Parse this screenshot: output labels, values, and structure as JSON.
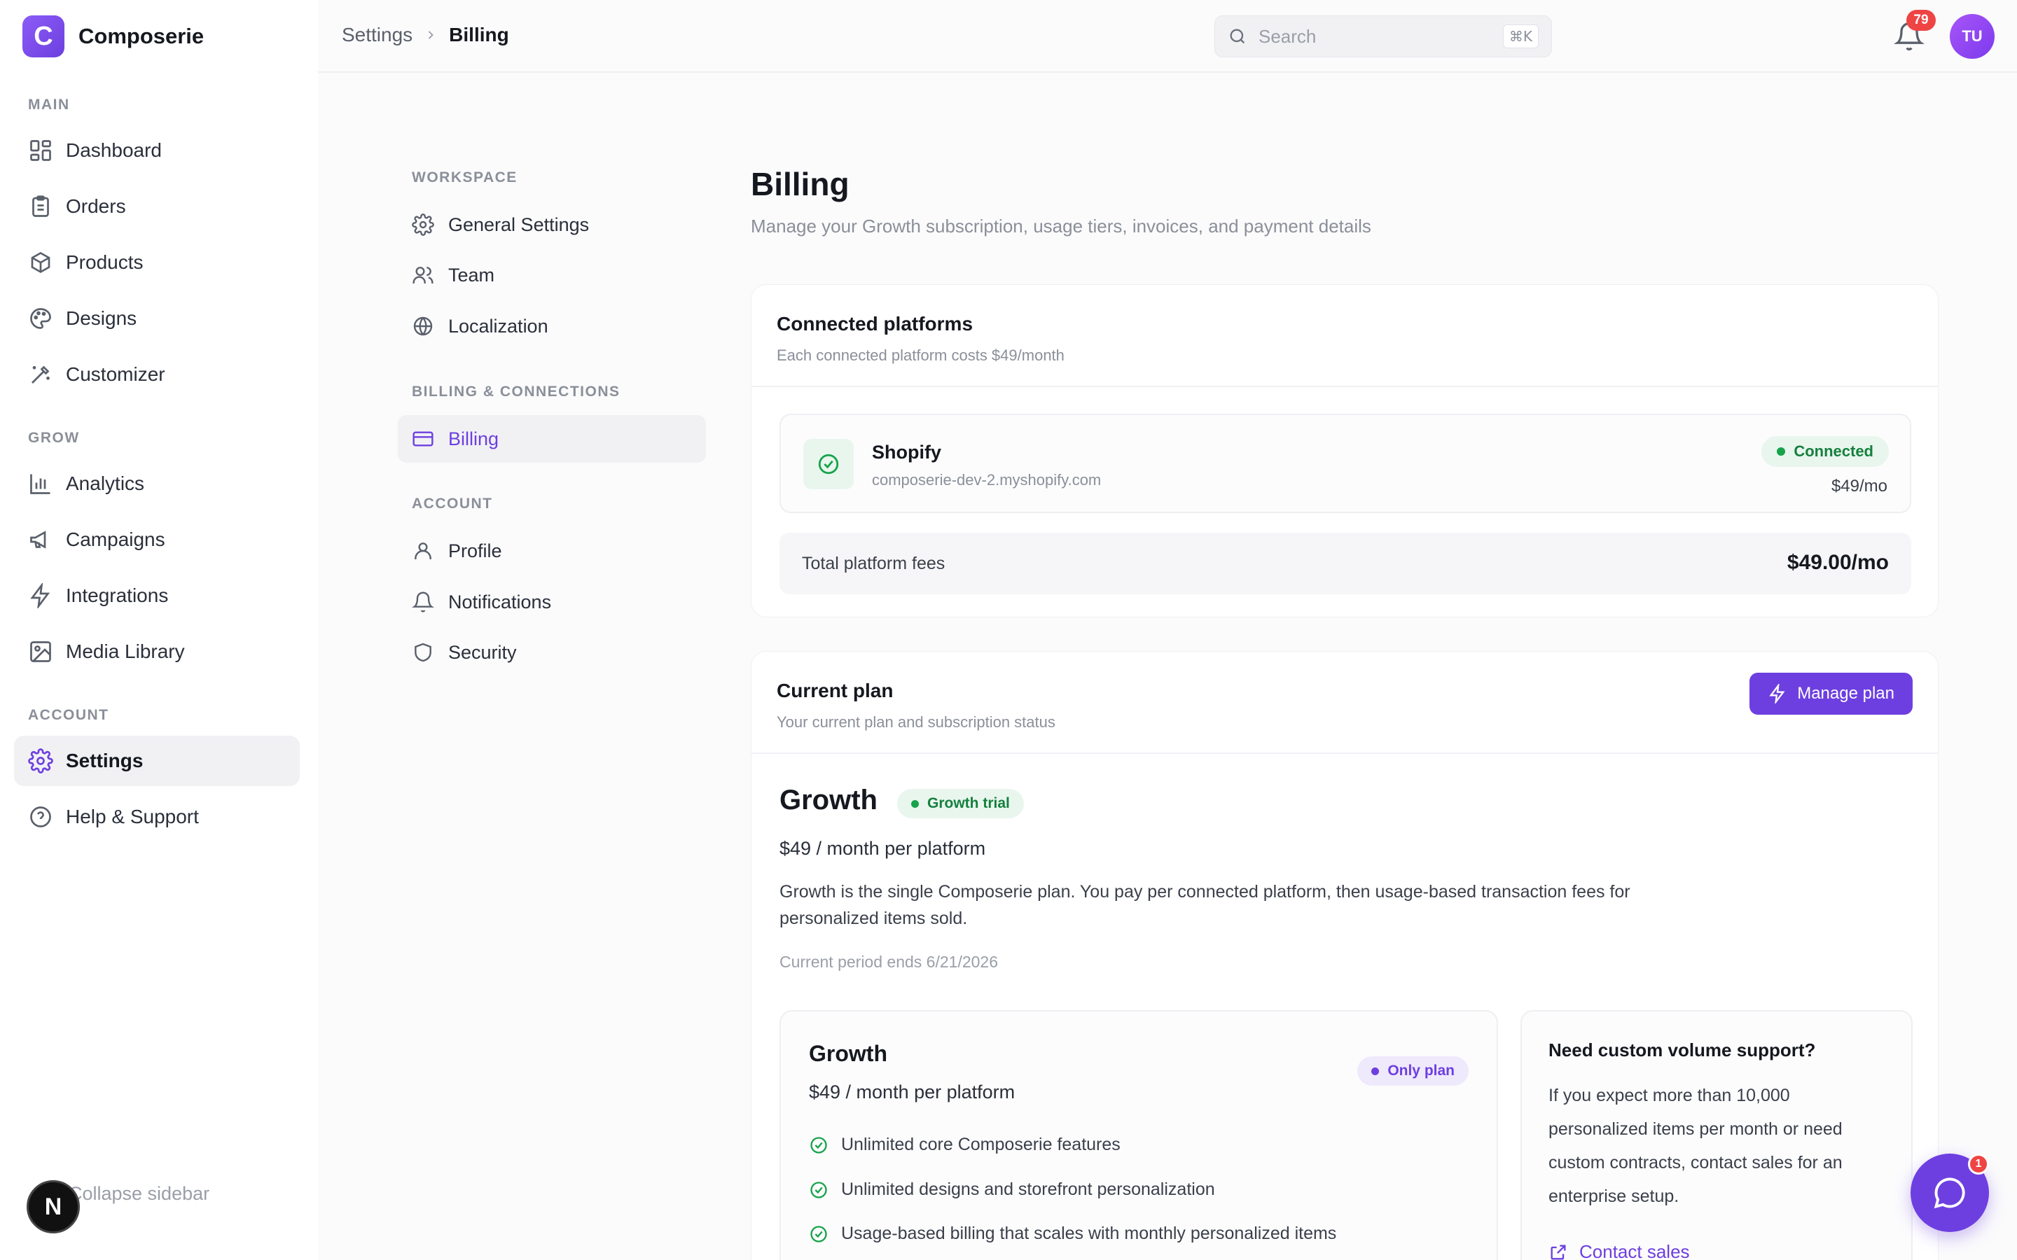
{
  "brand": {
    "logo_letter": "C",
    "name": "Composerie"
  },
  "sidebar": {
    "sections": [
      {
        "label": "MAIN"
      },
      {
        "label": "GROW"
      },
      {
        "label": "ACCOUNT"
      }
    ],
    "items": [
      {
        "label": "Dashboard",
        "icon": "grid-icon"
      },
      {
        "label": "Orders",
        "icon": "clipboard-icon"
      },
      {
        "label": "Products",
        "icon": "box-icon"
      },
      {
        "label": "Designs",
        "icon": "palette-icon"
      },
      {
        "label": "Customizer",
        "icon": "wand-icon"
      },
      {
        "label": "Analytics",
        "icon": "bar-chart-icon"
      },
      {
        "label": "Campaigns",
        "icon": "megaphone-icon"
      },
      {
        "label": "Integrations",
        "icon": "bolt-icon"
      },
      {
        "label": "Media Library",
        "icon": "image-icon"
      },
      {
        "label": "Settings",
        "icon": "gear-icon",
        "active": true
      },
      {
        "label": "Help & Support",
        "icon": "help-circle-icon"
      }
    ],
    "collapse_label": "Collapse sidebar",
    "n_badge": "N"
  },
  "topbar": {
    "breadcrumb": [
      "Settings",
      "Billing"
    ],
    "search_placeholder": "Search",
    "search_shortcut": "⌘K",
    "notification_count": "79",
    "avatar_initials": "TU"
  },
  "settings_nav": {
    "sections": [
      {
        "label": "WORKSPACE"
      },
      {
        "label": "BILLING & CONNECTIONS"
      },
      {
        "label": "ACCOUNT"
      }
    ],
    "items": [
      {
        "label": "General Settings",
        "icon": "gear-icon"
      },
      {
        "label": "Team",
        "icon": "users-icon"
      },
      {
        "label": "Localization",
        "icon": "globe-icon"
      },
      {
        "label": "Billing",
        "icon": "credit-card-icon",
        "active": true
      },
      {
        "label": "Profile",
        "icon": "user-icon"
      },
      {
        "label": "Notifications",
        "icon": "bell-icon"
      },
      {
        "label": "Security",
        "icon": "shield-icon"
      }
    ]
  },
  "page": {
    "title": "Billing",
    "subtitle": "Manage your Growth subscription, usage tiers, invoices, and payment details"
  },
  "connected_platforms": {
    "title": "Connected platforms",
    "description": "Each connected platform costs $49/month",
    "platform": {
      "name": "Shopify",
      "url": "composerie-dev-2.myshopify.com",
      "status": "Connected",
      "price": "$49/mo"
    },
    "total_label": "Total platform fees",
    "total_value": "$49.00/mo"
  },
  "current_plan": {
    "title": "Current plan",
    "description": "Your current plan and subscription status",
    "manage_button": "Manage plan",
    "plan_name": "Growth",
    "plan_badge": "Growth trial",
    "plan_price": "$49 / month per platform",
    "plan_description": "Growth is the single Composerie plan. You pay per connected platform, then usage-based transaction fees for personalized items sold.",
    "period": "Current period ends 6/21/2026",
    "plan_card": {
      "name": "Growth",
      "badge": "Only plan",
      "price": "$49 / month per platform",
      "features": [
        "Unlimited core Composerie features",
        "Unlimited designs and storefront personalization",
        "Usage-based billing that scales with monthly personalized items"
      ]
    },
    "custom_card": {
      "title": "Need custom volume support?",
      "text": "If you expect more than 10,000 personalized items per month or need custom contracts, contact sales for an enterprise setup.",
      "link": "Contact sales"
    }
  },
  "chat": {
    "unread_count": "1"
  },
  "colors": {
    "accent": "#6d3fe0",
    "success": "#16a34a",
    "danger": "#ef4444"
  }
}
